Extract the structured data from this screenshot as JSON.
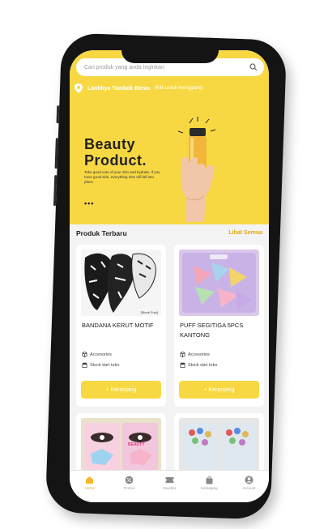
{
  "search": {
    "placeholder": "Cari produk yang anda inginkan"
  },
  "location": {
    "store": "Lantikya Tambak Beras",
    "status": "(Klik untuk mengganti)"
  },
  "banner": {
    "title_line1": "Beauty",
    "title_line2": "Product.",
    "subtitle": "Take good care of your skin and hydrate, If you have good skin, everything else will fall into place.",
    "dots": "•••"
  },
  "section": {
    "title": "Produk Terbaru",
    "more": "Lihat Semua"
  },
  "products": [
    {
      "name": "BANDANA KERUT MOTIF",
      "category": "Accesories",
      "stock": "Stock dari toko",
      "image_caption": "[Stock Foto]",
      "button": "+ Keranjang"
    },
    {
      "name": "PUFF SEGITIGA 5PCS KANTONG",
      "category": "Accesories",
      "stock": "Stock dari toko",
      "button": "+ Keranjang"
    },
    {
      "name": "",
      "image_text": "BEAUTY"
    },
    {
      "name": ""
    }
  ],
  "nav": [
    {
      "label": "Home",
      "icon": "home-icon"
    },
    {
      "label": "Promo",
      "icon": "percent-icon"
    },
    {
      "label": "Voucher",
      "icon": "ticket-icon"
    },
    {
      "label": "Keranjang",
      "icon": "bag-icon"
    },
    {
      "label": "Account",
      "icon": "user-icon"
    }
  ],
  "colors": {
    "accent": "#f7d843",
    "link": "#e3a914",
    "frame": "#141414"
  }
}
